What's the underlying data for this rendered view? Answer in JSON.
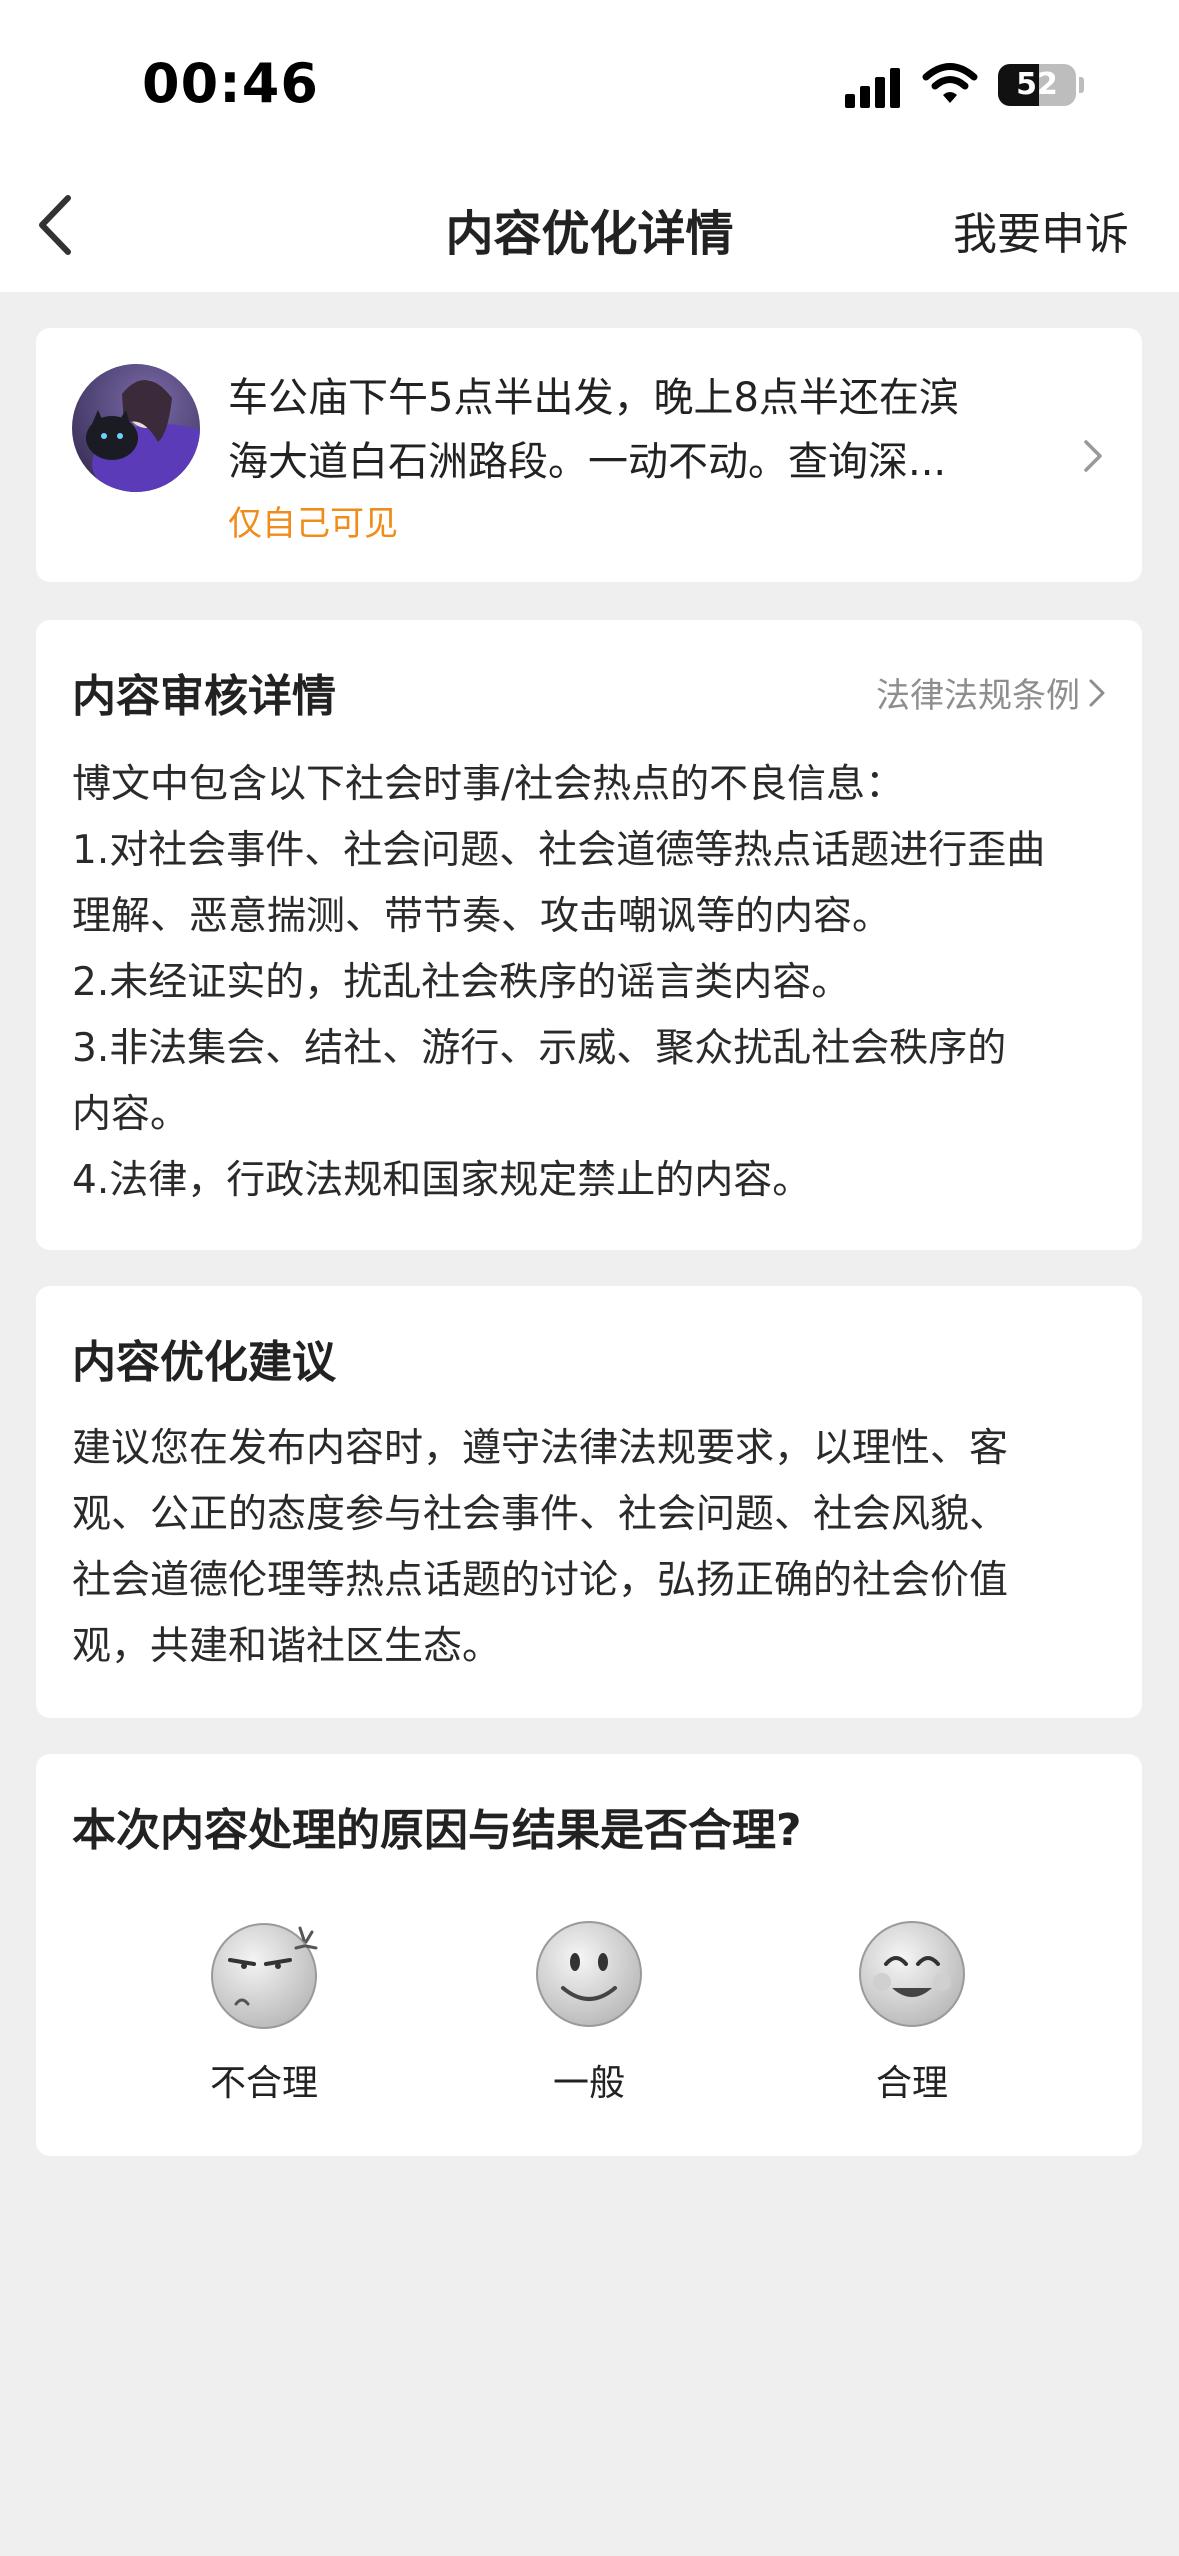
{
  "status_bar": {
    "time": "00:46",
    "battery_level": "52"
  },
  "header": {
    "title": "内容优化详情",
    "appeal_label": "我要申诉"
  },
  "post": {
    "lines": [
      "车公庙下午5点半出发，晚上8点半还在滨",
      "海大道白石洲路段。一动不动。查询深..."
    ],
    "visibility": "仅自己可见"
  },
  "review": {
    "title": "内容审核详情",
    "law_link": "法律法规条例",
    "lines": [
      "博文中包含以下社会时事/社会热点的不良信息：",
      "1.对社会事件、社会问题、社会道德等热点话题进行歪曲",
      "理解、恶意揣测、带节奏、攻击嘲讽等的内容。",
      "2.未经证实的，扰乱社会秩序的谣言类内容。",
      "3.非法集会、结社、游行、示威、聚众扰乱社会秩序的",
      "内容。",
      "4.法律，行政法规和国家规定禁止的内容。"
    ]
  },
  "advice": {
    "title": "内容优化建议",
    "lines": [
      "建议您在发布内容时，遵守法律法规要求，以理性、客",
      "观、公正的态度参与社会事件、社会问题、社会风貌、",
      "社会道德伦理等热点话题的讨论，弘扬正确的社会价值",
      "观，共建和谐社区生态。"
    ]
  },
  "feedback": {
    "question": "本次内容处理的原因与结果是否合理?",
    "options": [
      {
        "label": "不合理",
        "icon": "annoyed-face-icon"
      },
      {
        "label": "一般",
        "icon": "neutral-face-icon"
      },
      {
        "label": "合理",
        "icon": "happy-face-icon"
      }
    ]
  }
}
